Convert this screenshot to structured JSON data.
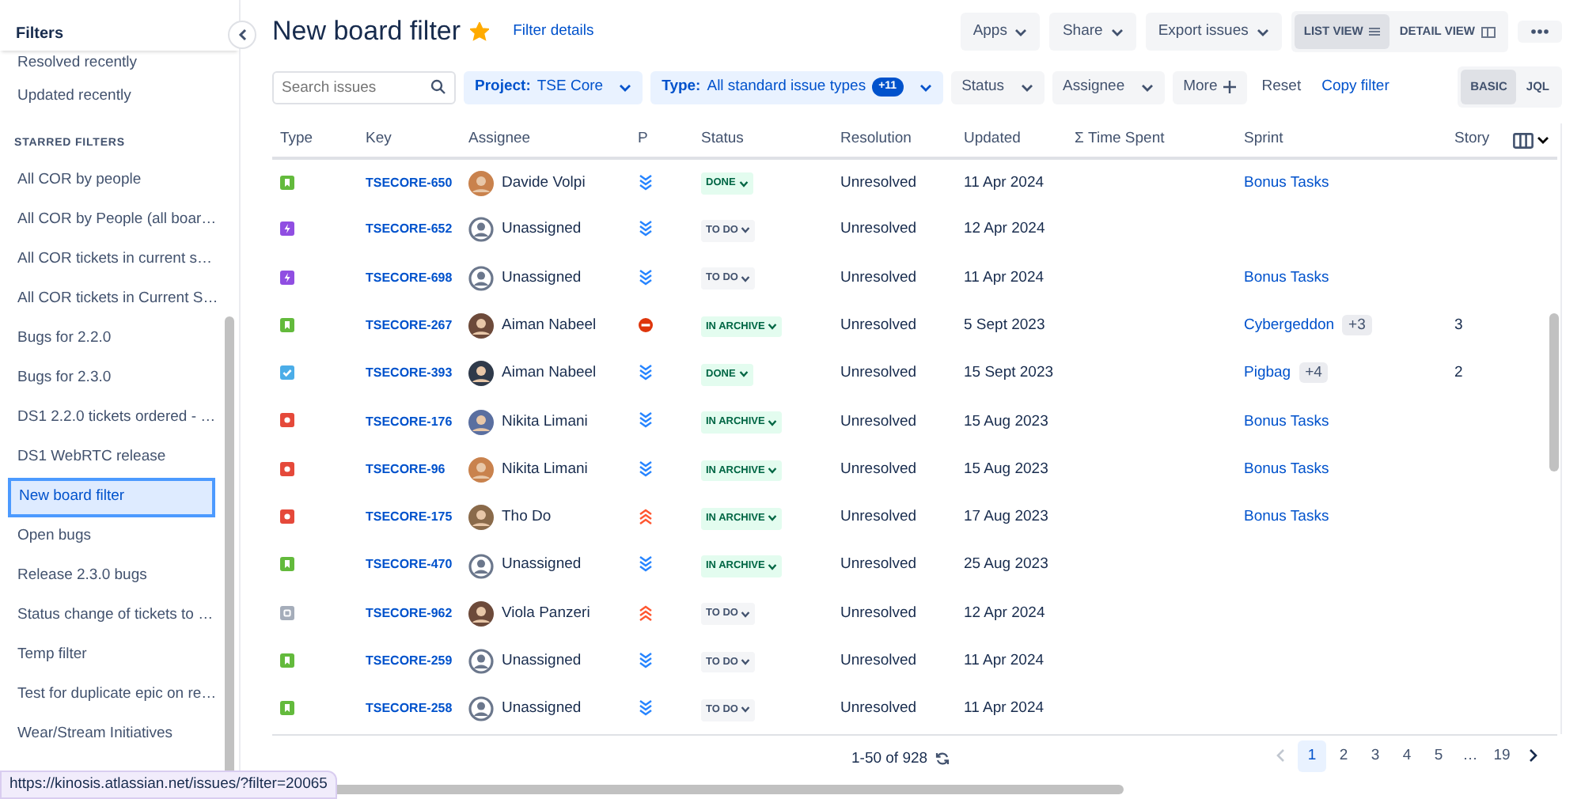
{
  "sidebar": {
    "title": "Filters",
    "items": [
      {
        "label": "Resolved recently",
        "kind": "item",
        "selected": false
      },
      {
        "label": "Updated recently",
        "kind": "item",
        "selected": false
      },
      {
        "label": "STARRED FILTERS",
        "kind": "heading"
      },
      {
        "label": "All COR by people",
        "kind": "item",
        "selected": false
      },
      {
        "label": "All COR by People (all boar…",
        "kind": "item",
        "selected": false
      },
      {
        "label": "All COR tickets in current s…",
        "kind": "item",
        "selected": false
      },
      {
        "label": "All COR tickets in Current S…",
        "kind": "item",
        "selected": false
      },
      {
        "label": "Bugs for 2.2.0",
        "kind": "item",
        "selected": false
      },
      {
        "label": "Bugs for 2.3.0",
        "kind": "item",
        "selected": false
      },
      {
        "label": "DS1 2.2.0 tickets ordered - …",
        "kind": "item",
        "selected": false
      },
      {
        "label": "DS1 WebRTC release",
        "kind": "item",
        "selected": false
      },
      {
        "label": "New board filter",
        "kind": "item",
        "selected": true
      },
      {
        "label": "Open bugs",
        "kind": "item",
        "selected": false
      },
      {
        "label": "Release 2.3.0 bugs",
        "kind": "item",
        "selected": false
      },
      {
        "label": "Status change of tickets to …",
        "kind": "item",
        "selected": false
      },
      {
        "label": "Temp filter",
        "kind": "item",
        "selected": false
      },
      {
        "label": "Test for duplicate epic on re…",
        "kind": "item",
        "selected": false
      },
      {
        "label": "Wear/Stream Initiatives",
        "kind": "item",
        "selected": false
      }
    ]
  },
  "header": {
    "title": "New board filter",
    "starred": true,
    "details_link": "Filter details",
    "actions": [
      "Apps",
      "Share",
      "Export issues"
    ],
    "views": [
      {
        "label": "LIST VIEW",
        "selected": true
      },
      {
        "label": "DETAIL VIEW",
        "selected": false
      }
    ]
  },
  "filters": {
    "search": {
      "placeholder": "Search issues"
    },
    "chips": [
      {
        "label": "Project:",
        "value": "TSE Core",
        "active": true
      },
      {
        "label": "Type:",
        "value": "All standard issue types",
        "badge": "+11",
        "active": true
      },
      {
        "label": "Status",
        "active": false
      },
      {
        "label": "Assignee",
        "active": false
      }
    ],
    "more": "More",
    "reset": "Reset",
    "copy": "Copy filter",
    "modes": [
      {
        "label": "BASIC",
        "selected": true
      },
      {
        "label": "JQL",
        "selected": false
      }
    ]
  },
  "table": {
    "columns": [
      "Type",
      "Key",
      "Assignee",
      "P",
      "Status",
      "Resolution",
      "Updated",
      "Σ Time Spent",
      "Sprint",
      "Story"
    ],
    "rows": [
      {
        "type": {
          "kind": "story"
        },
        "key": "TSECORE-650",
        "assignee": {
          "name": "Davide Volpi",
          "kind": "person"
        },
        "priority": {
          "kind": "lowest"
        },
        "status": {
          "label": "DONE",
          "kind": "done"
        },
        "resolution": "Unresolved",
        "updated": "11 Apr 2024",
        "sprint": "Bonus Tasks"
      },
      {
        "type": {
          "kind": "epic"
        },
        "key": "TSECORE-652",
        "assignee": {
          "name": "Unassigned",
          "kind": "none"
        },
        "priority": {
          "kind": "lowest"
        },
        "status": {
          "label": "TO DO",
          "kind": "todo"
        },
        "resolution": "Unresolved",
        "updated": "12 Apr 2024"
      },
      {
        "type": {
          "kind": "epic"
        },
        "key": "TSECORE-698",
        "assignee": {
          "name": "Unassigned",
          "kind": "none"
        },
        "priority": {
          "kind": "lowest"
        },
        "status": {
          "label": "TO DO",
          "kind": "todo"
        },
        "resolution": "Unresolved",
        "updated": "11 Apr 2024",
        "sprint": "Bonus Tasks"
      },
      {
        "type": {
          "kind": "story"
        },
        "key": "TSECORE-267",
        "assignee": {
          "name": "Aiman Nabeel",
          "kind": "person"
        },
        "priority": {
          "kind": "blocker"
        },
        "status": {
          "label": "IN ARCHIVE",
          "kind": "done"
        },
        "resolution": "Unresolved",
        "updated": "5 Sept 2023",
        "sprint": "Cybergeddon",
        "sprint_more": "+3",
        "story": "3"
      },
      {
        "type": {
          "kind": "task"
        },
        "key": "TSECORE-393",
        "assignee": {
          "name": "Aiman Nabeel",
          "kind": "person"
        },
        "priority": {
          "kind": "lowest"
        },
        "status": {
          "label": "DONE",
          "kind": "done"
        },
        "resolution": "Unresolved",
        "updated": "15 Sept 2023",
        "sprint": "Pigbag",
        "sprint_more": "+4",
        "story": "2"
      },
      {
        "type": {
          "kind": "bug"
        },
        "key": "TSECORE-176",
        "assignee": {
          "name": "Nikita Limani",
          "kind": "person"
        },
        "priority": {
          "kind": "lowest"
        },
        "status": {
          "label": "IN ARCHIVE",
          "kind": "done"
        },
        "resolution": "Unresolved",
        "updated": "15 Aug 2023",
        "sprint": "Bonus Tasks"
      },
      {
        "type": {
          "kind": "bug"
        },
        "key": "TSECORE-96",
        "assignee": {
          "name": "Nikita Limani",
          "kind": "person"
        },
        "priority": {
          "kind": "lowest"
        },
        "status": {
          "label": "IN ARCHIVE",
          "kind": "done"
        },
        "resolution": "Unresolved",
        "updated": "15 Aug 2023",
        "sprint": "Bonus Tasks"
      },
      {
        "type": {
          "kind": "bug"
        },
        "key": "TSECORE-175",
        "assignee": {
          "name": "Tho Do",
          "kind": "person"
        },
        "priority": {
          "kind": "highest"
        },
        "status": {
          "label": "IN ARCHIVE",
          "kind": "done"
        },
        "resolution": "Unresolved",
        "updated": "17 Aug 2023",
        "sprint": "Bonus Tasks"
      },
      {
        "type": {
          "kind": "story"
        },
        "key": "TSECORE-470",
        "assignee": {
          "name": "Unassigned",
          "kind": "none"
        },
        "priority": {
          "kind": "lowest"
        },
        "status": {
          "label": "IN ARCHIVE",
          "kind": "done"
        },
        "resolution": "Unresolved",
        "updated": "25 Aug 2023"
      },
      {
        "type": {
          "kind": "other"
        },
        "key": "TSECORE-962",
        "assignee": {
          "name": "Viola Panzeri",
          "kind": "person"
        },
        "priority": {
          "kind": "highest"
        },
        "status": {
          "label": "TO DO",
          "kind": "todo"
        },
        "resolution": "Unresolved",
        "updated": "12 Apr 2024"
      },
      {
        "type": {
          "kind": "story"
        },
        "key": "TSECORE-259",
        "assignee": {
          "name": "Unassigned",
          "kind": "none"
        },
        "priority": {
          "kind": "lowest"
        },
        "status": {
          "label": "TO DO",
          "kind": "todo"
        },
        "resolution": "Unresolved",
        "updated": "11 Apr 2024"
      },
      {
        "type": {
          "kind": "story"
        },
        "key": "TSECORE-258",
        "assignee": {
          "name": "Unassigned",
          "kind": "none"
        },
        "priority": {
          "kind": "lowest"
        },
        "status": {
          "label": "TO DO",
          "kind": "todo"
        },
        "resolution": "Unresolved",
        "updated": "11 Apr 2024"
      }
    ]
  },
  "pagination": {
    "summary": "1-50 of 928",
    "pages": [
      {
        "label": "1",
        "selected": true
      },
      {
        "label": "2",
        "selected": false
      },
      {
        "label": "3",
        "selected": false
      },
      {
        "label": "4",
        "selected": false
      },
      {
        "label": "5",
        "selected": false
      },
      {
        "label": "…",
        "selected": false
      },
      {
        "label": "19",
        "selected": false
      }
    ]
  },
  "status_url": "https://kinosis.atlassian.net/issues/?filter=20065"
}
